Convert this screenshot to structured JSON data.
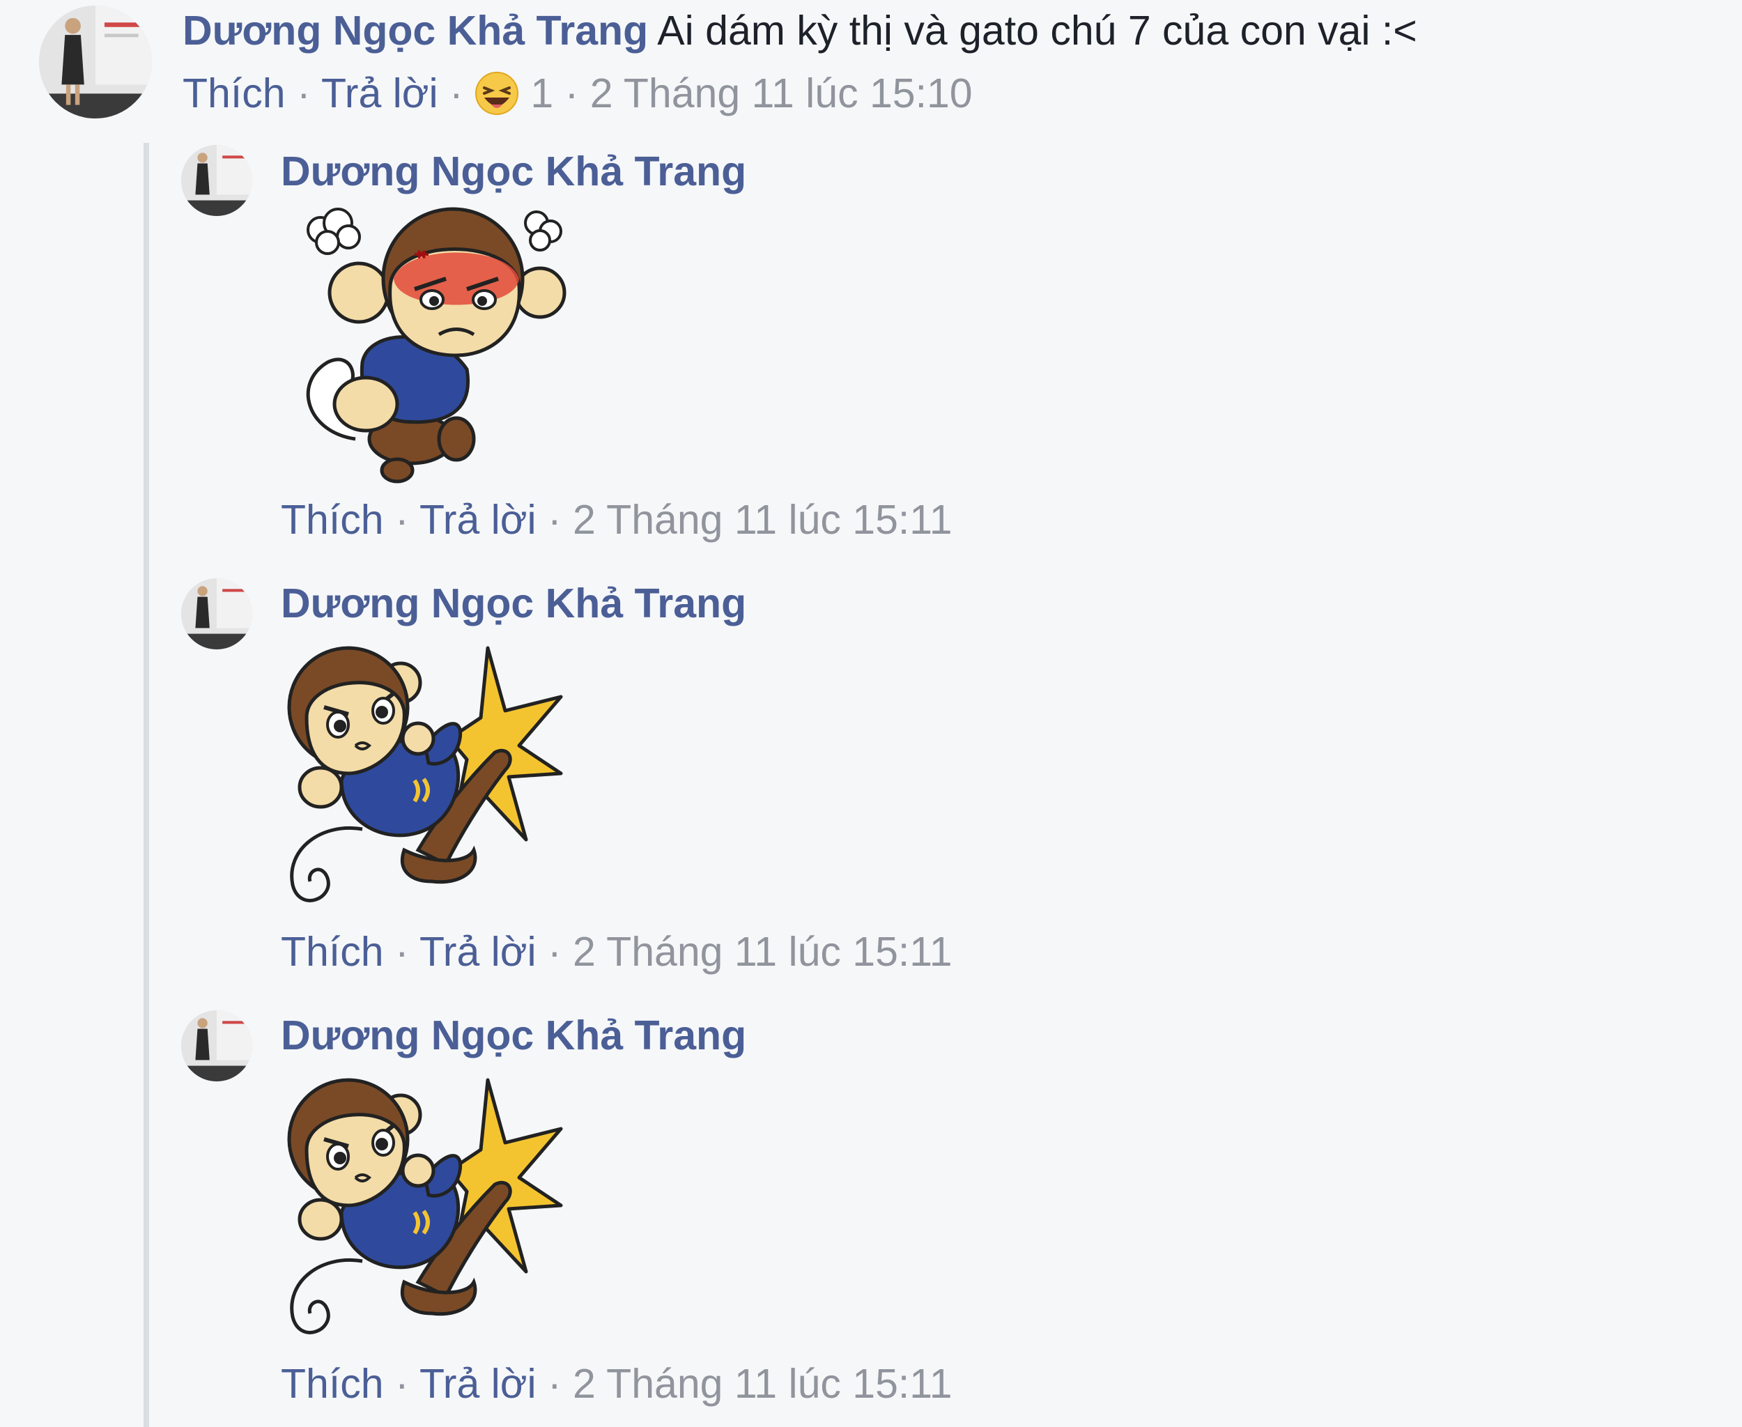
{
  "comment": {
    "author": "Dương Ngọc Khả Trang",
    "text": "Ai dám kỳ thị và gato chú 7 của con vại :<",
    "like_label": "Thích",
    "reply_label": "Trả lời",
    "reaction_icon": "laughing-emoji-icon",
    "reaction_count": "1",
    "timestamp": "2 Tháng 11 lúc 15:10"
  },
  "replies": [
    {
      "author": "Dương Ngọc Khả Trang",
      "sticker": "angry-monkey-sticker",
      "like_label": "Thích",
      "reply_label": "Trả lời",
      "timestamp": "2 Tháng 11 lúc 15:11"
    },
    {
      "author": "Dương Ngọc Khả Trang",
      "sticker": "kicking-monkey-sticker",
      "like_label": "Thích",
      "reply_label": "Trả lời",
      "timestamp": "2 Tháng 11 lúc 15:11"
    },
    {
      "author": "Dương Ngọc Khả Trang",
      "sticker": "kicking-monkey-sticker",
      "like_label": "Thích",
      "reply_label": "Trả lời",
      "timestamp": "2 Tháng 11 lúc 15:11"
    }
  ],
  "colors": {
    "background": "#f6f7f9",
    "link": "#4b5f96",
    "meta": "#90949c",
    "text": "#1d2129",
    "thread_line": "#dadde1"
  }
}
